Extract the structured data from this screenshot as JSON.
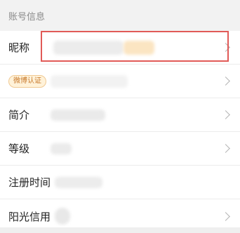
{
  "section": {
    "title": "账号信息"
  },
  "rows": [
    {
      "label": "昵称",
      "has_chevron": true
    },
    {
      "badge": "微博认证",
      "has_chevron": true
    },
    {
      "label": "简介",
      "has_chevron": true
    },
    {
      "label": "等级",
      "has_chevron": true
    },
    {
      "label": "注册时间",
      "has_chevron": false
    },
    {
      "label": "阳光信用",
      "has_chevron": true
    }
  ],
  "colors": {
    "highlight_border": "#e15a57",
    "badge_text": "#c7782b",
    "badge_bg": "#fff2d9"
  }
}
